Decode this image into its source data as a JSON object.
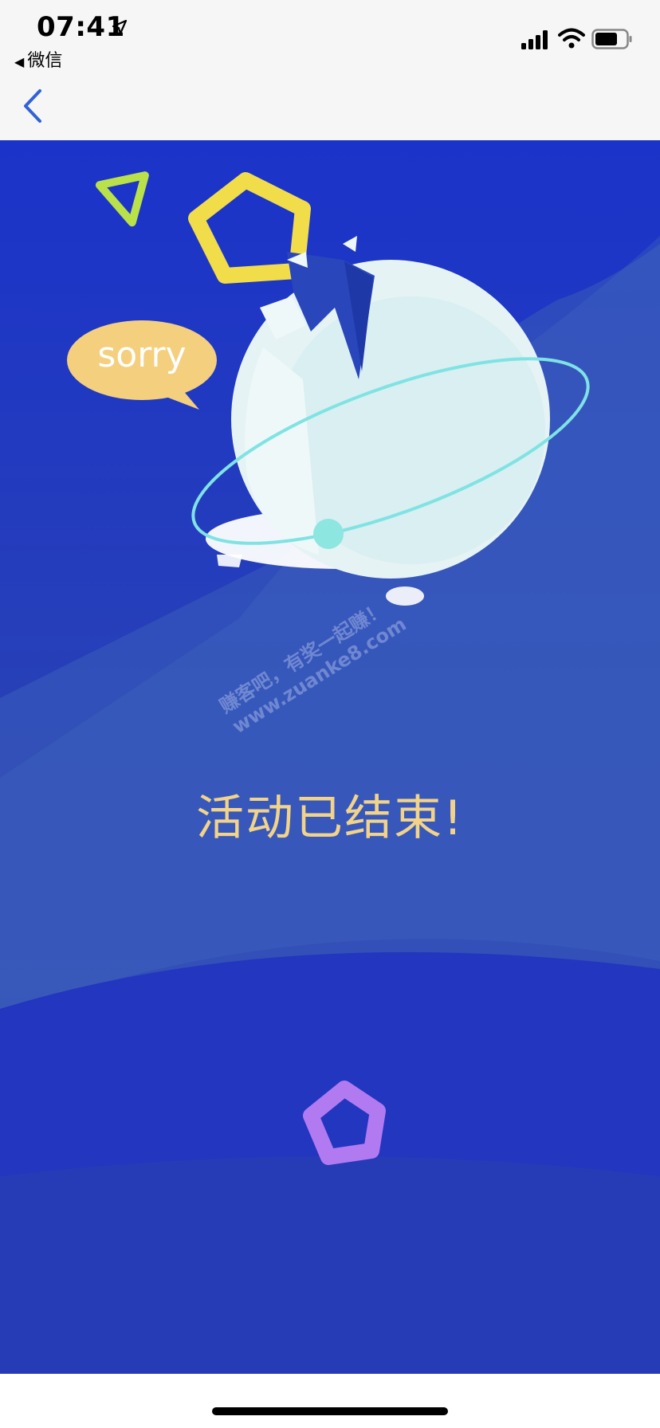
{
  "status_bar": {
    "time": "07:41",
    "back_app_label": "微信",
    "icons": [
      "location-arrow-icon",
      "cellular-signal-icon",
      "wifi-icon",
      "battery-icon"
    ]
  },
  "nav": {
    "back_icon": "chevron-left-icon",
    "accent_color": "#2f63d6"
  },
  "illustration": {
    "bubble_text": "sorry",
    "shapes": [
      "triangle-outline-green",
      "pentagon-outline-yellow",
      "pentagon-outline-purple"
    ],
    "planet": "cracked-planet-with-ring"
  },
  "message": {
    "text": "活动已结束!",
    "color": "#f2d38a"
  },
  "watermark": {
    "line1": "赚客吧，有奖一起赚！",
    "line2": "www.zuanke8.com"
  },
  "colors": {
    "background_top": "#1b33c9",
    "background_bottom": "#2d44b0"
  }
}
